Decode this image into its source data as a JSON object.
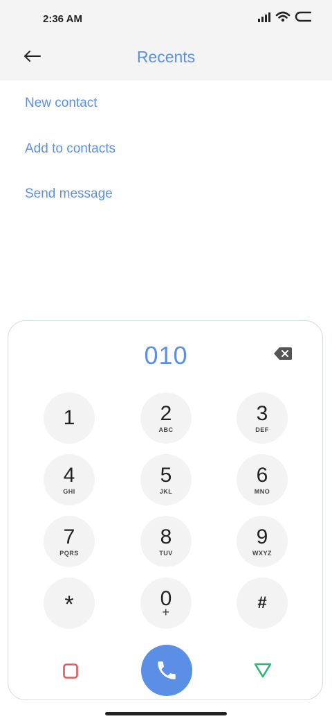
{
  "status_bar": {
    "time": "2:36 AM"
  },
  "header": {
    "title": "Recents"
  },
  "actions": [
    {
      "label": "New contact"
    },
    {
      "label": "Add to contacts"
    },
    {
      "label": "Send message"
    }
  ],
  "dialer": {
    "number": "010",
    "keys": [
      {
        "digit": "1",
        "letters": ""
      },
      {
        "digit": "2",
        "letters": "ABC"
      },
      {
        "digit": "3",
        "letters": "DEF"
      },
      {
        "digit": "4",
        "letters": "GHI"
      },
      {
        "digit": "5",
        "letters": "JKL"
      },
      {
        "digit": "6",
        "letters": "MNO"
      },
      {
        "digit": "7",
        "letters": "PQRS"
      },
      {
        "digit": "8",
        "letters": "TUV"
      },
      {
        "digit": "9",
        "letters": "WXYZ"
      },
      {
        "digit": "*",
        "letters": ""
      },
      {
        "digit": "0",
        "letters": "+"
      },
      {
        "digit": "#",
        "letters": ""
      }
    ]
  },
  "colors": {
    "accent": "#5b8fe6",
    "header_bg": "#f4f4f4",
    "key_bg": "#f3f3f3",
    "square_button": "#e05a5a",
    "triangle_button": "#2bb673"
  },
  "icons": {
    "back": "arrow-left-icon",
    "backspace": "backspace-icon",
    "call": "phone-icon",
    "left_nav": "square-icon",
    "right_nav": "triangle-down-icon",
    "signal": "signal-icon",
    "wifi": "wifi-icon",
    "battery": "battery-icon"
  }
}
